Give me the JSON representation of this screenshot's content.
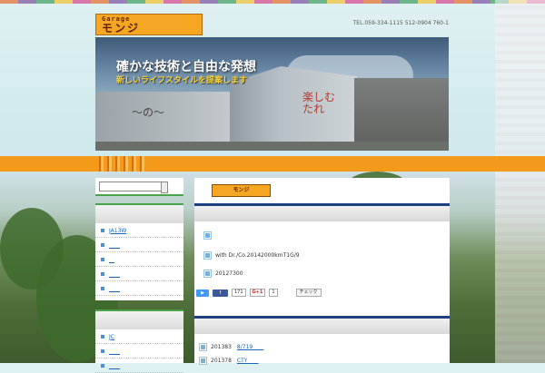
{
  "header": {
    "logo_line1": "Garage",
    "logo_line2": "モンジ",
    "tel": "TEL.059-334-1115 512-0904 760-1"
  },
  "hero": {
    "title": "確かな技術と自由な発想",
    "subtitle": "新しいライフスタイルを提案します"
  },
  "sidebar": {
    "menu1": [
      "JA13W",
      "",
      "",
      "",
      ""
    ],
    "menu2": [
      "JC",
      "",
      ""
    ]
  },
  "main": {
    "mini_logo": "モンジ",
    "rows": [
      "",
      "with Dr./Co.20142000kmT1G/9",
      "20127300"
    ],
    "share": {
      "tweet": "",
      "facebook": "",
      "facebook_count": "171",
      "gplus": "G+1",
      "gplus_count": "1",
      "check": "チェック"
    },
    "list": [
      {
        "text": "201383",
        "link": "8/719"
      },
      {
        "text": "201378",
        "link": "CTY"
      }
    ]
  }
}
